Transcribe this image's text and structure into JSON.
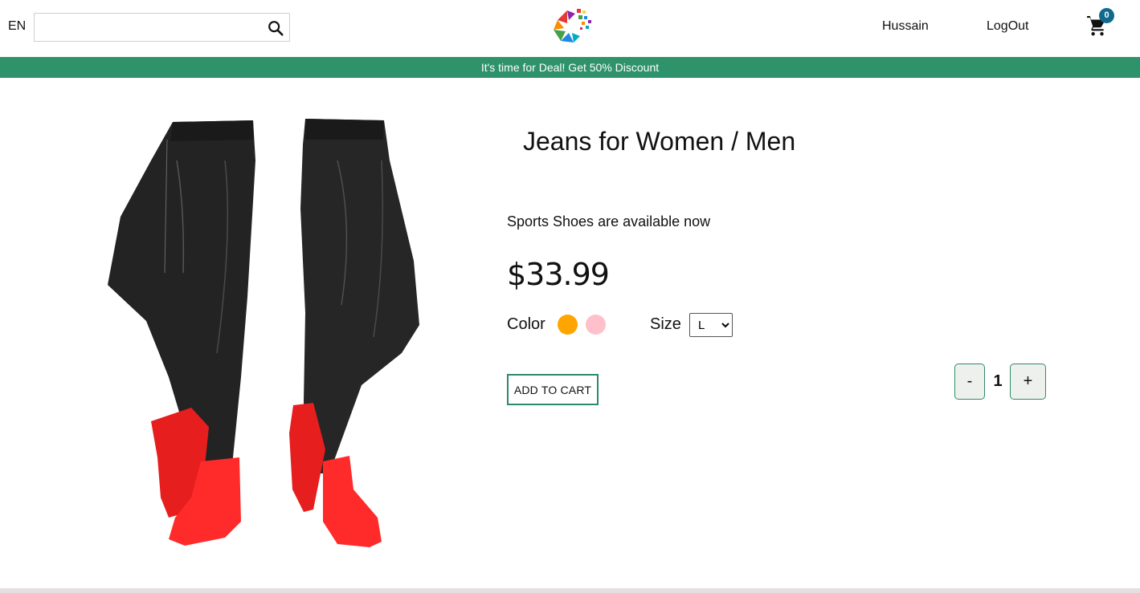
{
  "header": {
    "language": "EN",
    "search": {
      "value": "",
      "placeholder": ""
    },
    "user_name": "Hussain",
    "logout_label": "LogOut",
    "cart_count": "0",
    "icons": {
      "search": "search-icon",
      "cart": "cart-icon",
      "logo": "logo-icon"
    }
  },
  "promo_banner": {
    "text": "It's time for Deal! Get 50% Discount"
  },
  "product": {
    "title": "Jeans for Women / Men",
    "description": "Sports Shoes are available now",
    "price": "$33.99",
    "color_label": "Color",
    "colors": [
      "#FFA500",
      "#FFC0CB"
    ],
    "size_label": "Size",
    "size_selected": "L",
    "size_options": [
      "L"
    ],
    "add_to_cart_label": "ADD TO CART",
    "quantity": "1",
    "qty_minus_label": "-",
    "qty_plus_label": "+"
  },
  "theme": {
    "accent": "#2E936A",
    "badge": "#116A8C"
  }
}
